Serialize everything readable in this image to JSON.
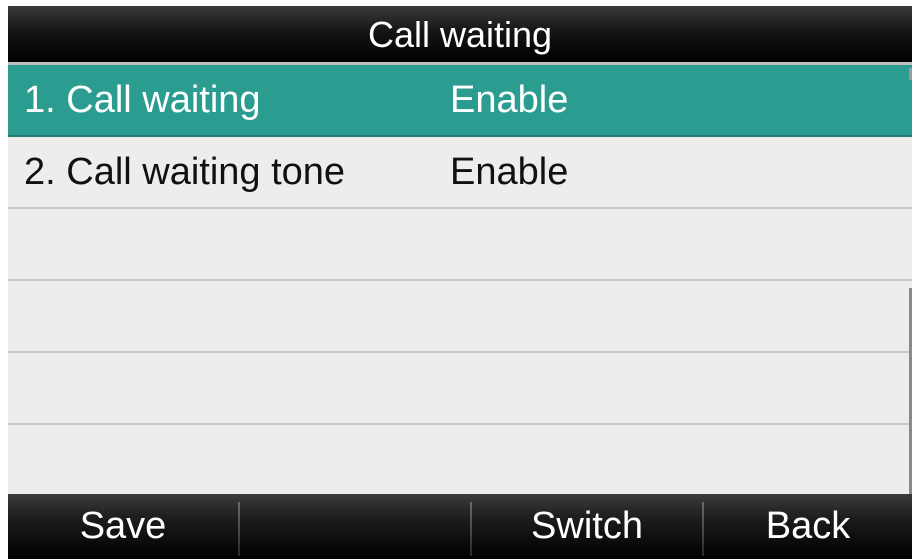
{
  "screen": {
    "title": "Call waiting"
  },
  "list": {
    "items": [
      {
        "label": "1. Call waiting",
        "value": "Enable",
        "selected": true
      },
      {
        "label": "2. Call waiting tone",
        "value": "Enable",
        "selected": false
      }
    ]
  },
  "softkeys": {
    "key1": "Save",
    "key2": "",
    "key3": "Switch",
    "key4": "Back"
  },
  "colors": {
    "selection": "#2a9d90",
    "background": "#efedeb",
    "bars": "#000000"
  }
}
